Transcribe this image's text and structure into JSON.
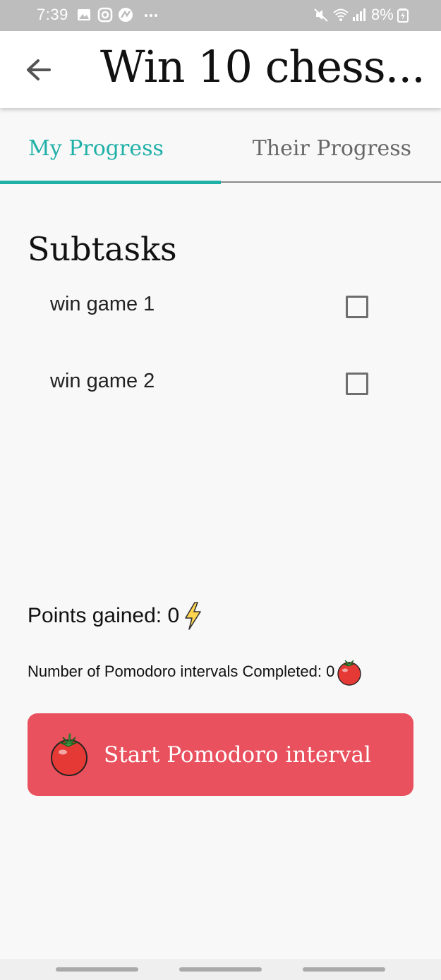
{
  "status_bar": {
    "time": "7:39",
    "battery": "8%",
    "icons": [
      "gallery-icon",
      "instagram-icon",
      "app-icon",
      "more-icon",
      "mute-icon",
      "wifi-icon",
      "signal-icon",
      "battery-icon"
    ]
  },
  "app_bar": {
    "title": "Win 10 chess..."
  },
  "tabs": [
    {
      "label": "My Progress",
      "active": true
    },
    {
      "label": "Their Progress",
      "active": false
    }
  ],
  "subtasks": {
    "title": "Subtasks",
    "items": [
      {
        "label": "win game 1",
        "checked": false
      },
      {
        "label": "win game 2",
        "checked": false
      }
    ]
  },
  "stats": {
    "points_label": "Points gained: 0",
    "pomodoros_label": "Number of Pomodoro intervals Completed: 0"
  },
  "start_button": {
    "label": "Start Pomodoro interval"
  },
  "colors": {
    "accent": "#1fb0a8",
    "button": "#e8515d",
    "status_bar": "#bdbdbd",
    "background": "#f8f8f8"
  }
}
